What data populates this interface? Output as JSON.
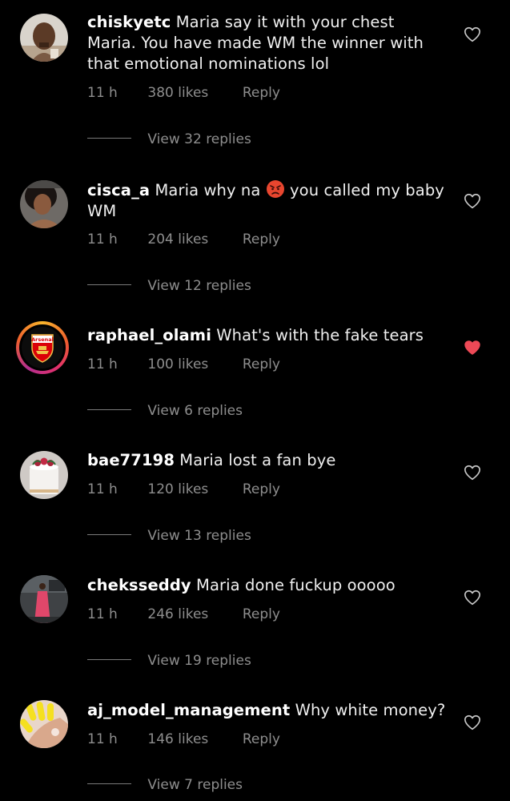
{
  "comments": [
    {
      "username": "chiskyetc",
      "text": "Maria say it with your chest Maria. You have made WM the winner with that emotional nominations lol",
      "time": "11 h",
      "likes": "380 likes",
      "reply": "Reply",
      "view_replies": "View 32 replies",
      "liked": false
    },
    {
      "username": "cisca_a",
      "text_before": "Maria why na",
      "emoji": "angry-face",
      "text_after": "you called my baby WM",
      "time": "11 h",
      "likes": "204 likes",
      "reply": "Reply",
      "view_replies": "View 12 replies",
      "liked": false
    },
    {
      "username": "raphael_olami",
      "text": "What's with the fake tears",
      "avatar_text": "Arsenal",
      "time": "11 h",
      "likes": "100 likes",
      "reply": "Reply",
      "view_replies": "View 6 replies",
      "liked": true
    },
    {
      "username": "bae77198",
      "text": "Maria lost a fan bye",
      "time": "11 h",
      "likes": "120 likes",
      "reply": "Reply",
      "view_replies": "View 13 replies",
      "liked": false
    },
    {
      "username": "cheksseddy",
      "text": "Maria done fuckup ooooo",
      "time": "11 h",
      "likes": "246 likes",
      "reply": "Reply",
      "view_replies": "View 19 replies",
      "liked": false
    },
    {
      "username": "aj_model_management",
      "text": "Why white money?",
      "time": "11 h",
      "likes": "146 likes",
      "reply": "Reply",
      "view_replies": "View 7 replies",
      "liked": false
    }
  ],
  "colors": {
    "background": "#000000",
    "text": "#f2f2f2",
    "meta": "#8e8e8e",
    "liked_heart": "#ed4956"
  }
}
